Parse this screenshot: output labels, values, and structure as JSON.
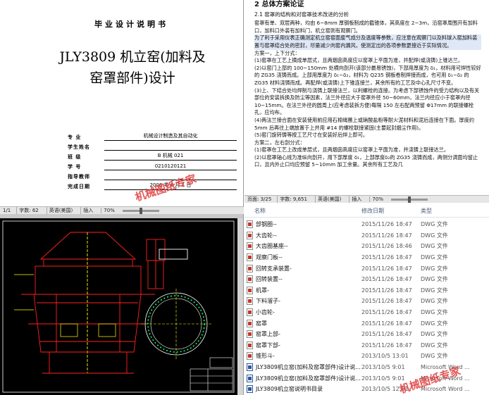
{
  "cover": {
    "header": "毕业设计说明书",
    "title_line1": "JLY3809 机立窑(加料及",
    "title_line2": "窑罩部件)设计",
    "fields": [
      {
        "label": "专 业",
        "value": "机械设计制造及其自动化"
      },
      {
        "label": "学生姓名",
        "value": ""
      },
      {
        "label": "班 级",
        "value": "B 机械 021"
      },
      {
        "label": "学 号",
        "value": "0210120121"
      },
      {
        "label": "指导教师",
        "value": ""
      },
      {
        "label": "完成日期",
        "value": "2006 年 6 月 1 日"
      }
    ]
  },
  "statusbar_left": {
    "page": "1/1",
    "wordcount": "字数: 62",
    "language": "英语(美国)",
    "mode": "插入",
    "zoom": "70%"
  },
  "statusbar_right": {
    "page": "页面: 3/25",
    "wordcount": "字数: 9,651",
    "language": "英语(美国)",
    "mode": "插入",
    "zoom": "70%"
  },
  "doc2": {
    "heading": "2 总体方案论证",
    "subheading": "2.1 窑罩的结构和对窑罩技术改进的分析",
    "paragraphs": [
      "窑罩有单、双层两种，均由 6~8mm 厚钢板制成的截锥体，其高度在 2~3m，沿窑罩周围开有加料口，加料口外装有加料门，机立窑则有观察门。",
      "为了利于采用仪表正确测定机立窑窑面废气成分及温度等参数，应注意在观察门以及料球入窑加料装置与窑罩结合处的密封，尽量减少向窑内漏风，使测定出的各项参数更接近于实际情况。",
      "方案一，上下分式：",
      "(1)窑罩在工艺上摘成单层式，且两烟囱高度应以窑罩上平面为准，并配焊(或浇铸)上锥达兰。",
      "(2)以窑门上部的 100~150mm 处横向剖开(该部分最易锈蚀)，下部用厚度为 δ₁，材料用可焊性较好的 ZG35 浇铸而成。上部用厚度为 δ₁−δ₂，材料为 Q235 钢板卷制焊接而成，也可用 δ₁−δ₂ 的 ZG35 材料浇铸而成。再配焊(或浇铸)上下锥连接兰，其余所有的工艺及中心孔尺寸不变。",
      "(3)上、下结合处均焊制与浇铸上联接法兰，以利螺栓的连接。为考虑下部锈蚀件的受力结构以及有关部位的安装拆换及防尘等因素，法兰外径应大于窑罩外径 50~60mm，法兰内径应小于窑罩内径 10~15mm。在法兰外径的圆周上(应考虑装拆方便)每隔 150 左右配两预留 Φ17mm 的联接螺栓孔，应均布。",
      "(4)两法兰接合面在安装使用前应用石棉绳蘸上或硝酸盐粉等耐火泥材料和泥后连接在下面。厚度约 5mm 后再往上端放置于上并用 #14 的螺栓联接紧固(主要起封烟尘作用)。",
      "(5)窑门旋转铸等按工艺尺寸在安装好后焊上即可。",
      "方案二，左右剖分式：",
      "(1)窑罩在工艺上改成单层式，且两烟囱高度应以窑罩上平面为准，并浇铸上联接达兰。",
      "(2)以窑罩轴心线为准纵向剖开，用下部厚度 δ₁，上部厚度δ₂的 ZG35 浇铸而成，两侧分调面均留止口，且内外止口均应预留 5~10mm 加工余量。其余所有工艺及几"
    ]
  },
  "files": {
    "columns": {
      "name": "名称",
      "date": "修改日期",
      "type": "类型"
    },
    "rows": [
      {
        "name": "部钢圈--",
        "date": "2015/11/26 18:47",
        "type": "DWG 文件",
        "kind": "dwg"
      },
      {
        "name": "大齿轮--",
        "date": "2015/11/26 18:47",
        "type": "DWG 文件",
        "kind": "dwg"
      },
      {
        "name": "大齿圈基座--",
        "date": "2015/11/26 18:46",
        "type": "DWG 文件",
        "kind": "dwg"
      },
      {
        "name": "观察门板--",
        "date": "2015/11/26 18:47",
        "type": "DWG 文件",
        "kind": "dwg"
      },
      {
        "name": "回转支承装置-",
        "date": "2015/11/26 18:47",
        "type": "DWG 文件",
        "kind": "dwg"
      },
      {
        "name": "回转装置--",
        "date": "2015/11/26 18:47",
        "type": "DWG 文件",
        "kind": "dwg"
      },
      {
        "name": "机罩-",
        "date": "2015/11/26 18:47",
        "type": "DWG 文件",
        "kind": "dwg"
      },
      {
        "name": "下料溜子-",
        "date": "2015/11/26 18:47",
        "type": "DWG 文件",
        "kind": "dwg"
      },
      {
        "name": "小齿轮-",
        "date": "2015/11/26 18:47",
        "type": "DWG 文件",
        "kind": "dwg"
      },
      {
        "name": "窑罩",
        "date": "2015/11/26 18:47",
        "type": "DWG 文件",
        "kind": "dwg"
      },
      {
        "name": "窑罩上部-",
        "date": "2015/11/26 18:47",
        "type": "DWG 文件",
        "kind": "dwg"
      },
      {
        "name": "窑罩下部-",
        "date": "2015/11/26 18:47",
        "type": "DWG 文件",
        "kind": "dwg"
      },
      {
        "name": "锥形斗-",
        "date": "2013/10/5 13:01",
        "type": "DWG 文件",
        "kind": "dwg"
      },
      {
        "name": "JLY3809机立窑(加料及窑罩部件)设计说...",
        "date": "2013/10/5 9:01",
        "type": "Microsoft Word ...",
        "kind": "word"
      },
      {
        "name": "JLY3809机立窑(加料及窑罩部件)设计说...",
        "date": "2013/10/5 9:01",
        "type": "Microsoft Word ...",
        "kind": "word"
      },
      {
        "name": "JLY3809机立窑说明书目录",
        "date": "2013/10/5 12:01",
        "type": "Microsoft Word ...",
        "kind": "word"
      },
      {
        "name": "JLY3809窑加料及窑罩摘要----甘为国 2...",
        "date": "2013/10/5 13:01",
        "type": "Microsoft Word ...",
        "kind": "word"
      }
    ]
  },
  "watermarks": {
    "top": "机械图纸专家",
    "bottom": "机械图纸专家"
  },
  "colors": {
    "cad_background": "#000000",
    "cad_red": "#ff2020",
    "cad_yellow": "#ffff00",
    "cad_white": "#ffffff",
    "watermark": "#e03a3a"
  }
}
